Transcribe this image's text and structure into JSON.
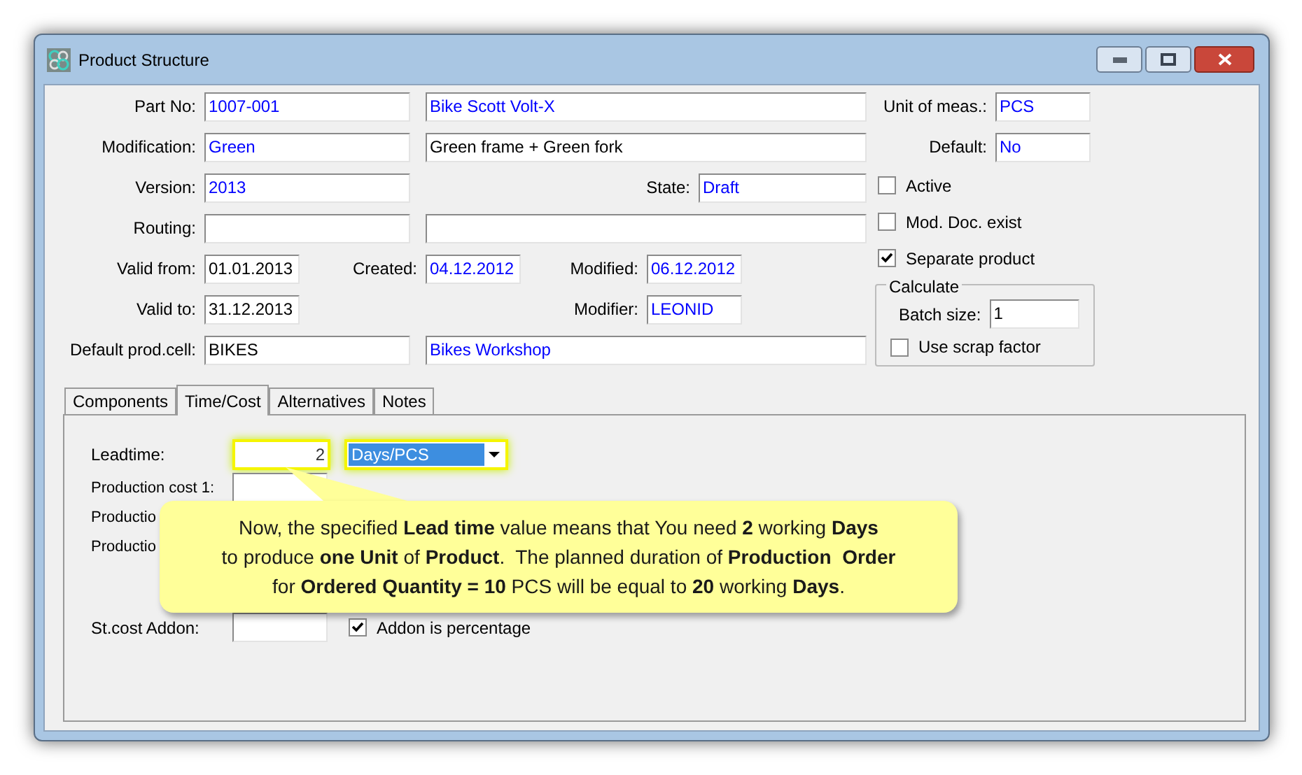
{
  "window": {
    "title": "Product Structure"
  },
  "header": {
    "part_no": {
      "label": "Part No:",
      "value": "1007-001",
      "color": "#0000ff"
    },
    "part_name": {
      "value": "Bike Scott Volt-X",
      "color": "#0000ff"
    },
    "modification": {
      "label": "Modification:",
      "value": "Green",
      "color": "#0000ff"
    },
    "modification_description": {
      "value": "Green frame + Green fork",
      "color": "#000000"
    },
    "version": {
      "label": "Version:",
      "value": "2013",
      "color": "#0000ff"
    },
    "state": {
      "label": "State:",
      "value": "Draft",
      "color": "#0000ff"
    },
    "routing": {
      "label": "Routing:"
    },
    "valid_from": {
      "label": "Valid from:",
      "value": "01.01.2013",
      "color": "#000000"
    },
    "created": {
      "label": "Created:",
      "value": "04.12.2012",
      "color": "#0000ff"
    },
    "modified": {
      "label": "Modified:",
      "value": "06.12.2012",
      "color": "#0000ff"
    },
    "valid_to": {
      "label": "Valid to:",
      "value": "31.12.2013",
      "color": "#000000"
    },
    "modifier": {
      "label": "Modifier:",
      "value": "LEONID",
      "color": "#0000ff"
    },
    "default_prod_cell": {
      "label": "Default prod.cell:",
      "value": "BIKES",
      "color": "#000000"
    },
    "prod_cell_name": {
      "value": "Bikes Workshop",
      "color": "#0000ff"
    },
    "unit_of_meas": {
      "label": "Unit of meas.:",
      "value": "PCS",
      "color": "#0000ff"
    },
    "default": {
      "label": "Default:",
      "value": "No",
      "color": "#0000ff"
    }
  },
  "options": [
    {
      "label": "Active",
      "checked": false
    },
    {
      "label": "Mod. Doc. exist",
      "checked": false
    },
    {
      "label": "Separate product",
      "checked": true
    }
  ],
  "calculate": {
    "title": "Calculate",
    "batch_size": {
      "label": "Batch size:",
      "value": "1"
    },
    "use_scrap_factor": {
      "label": "Use scrap factor",
      "checked": false
    }
  },
  "tabs": [
    {
      "label": "Components",
      "selected": false
    },
    {
      "label": "Time/Cost",
      "selected": true
    },
    {
      "label": "Alternatives",
      "selected": false
    },
    {
      "label": "Notes",
      "selected": false
    }
  ],
  "time_cost": {
    "leadtime": {
      "label": "Leadtime:",
      "value": "2",
      "unit": "Days/PCS",
      "highlighted": true
    },
    "production_cost_1": {
      "label": "Production cost 1:"
    },
    "production_cost_2": {
      "label": "Productio"
    },
    "production_cost_3": {
      "label": "Productio"
    },
    "st_cost_addon": {
      "label": "St.cost Addon:"
    },
    "addon_is_percentage": {
      "label": "Addon is percentage",
      "checked": true
    }
  },
  "callout": {
    "lines": [
      "Now, the specified **Lead time** value means that You need **2** working **Days**",
      "to produce **one Unit** of **Product**.  The planned duration of **Production  Order**",
      "for **Ordered Quantity = 10** PCS will be equal to **20** working **Days**."
    ]
  }
}
